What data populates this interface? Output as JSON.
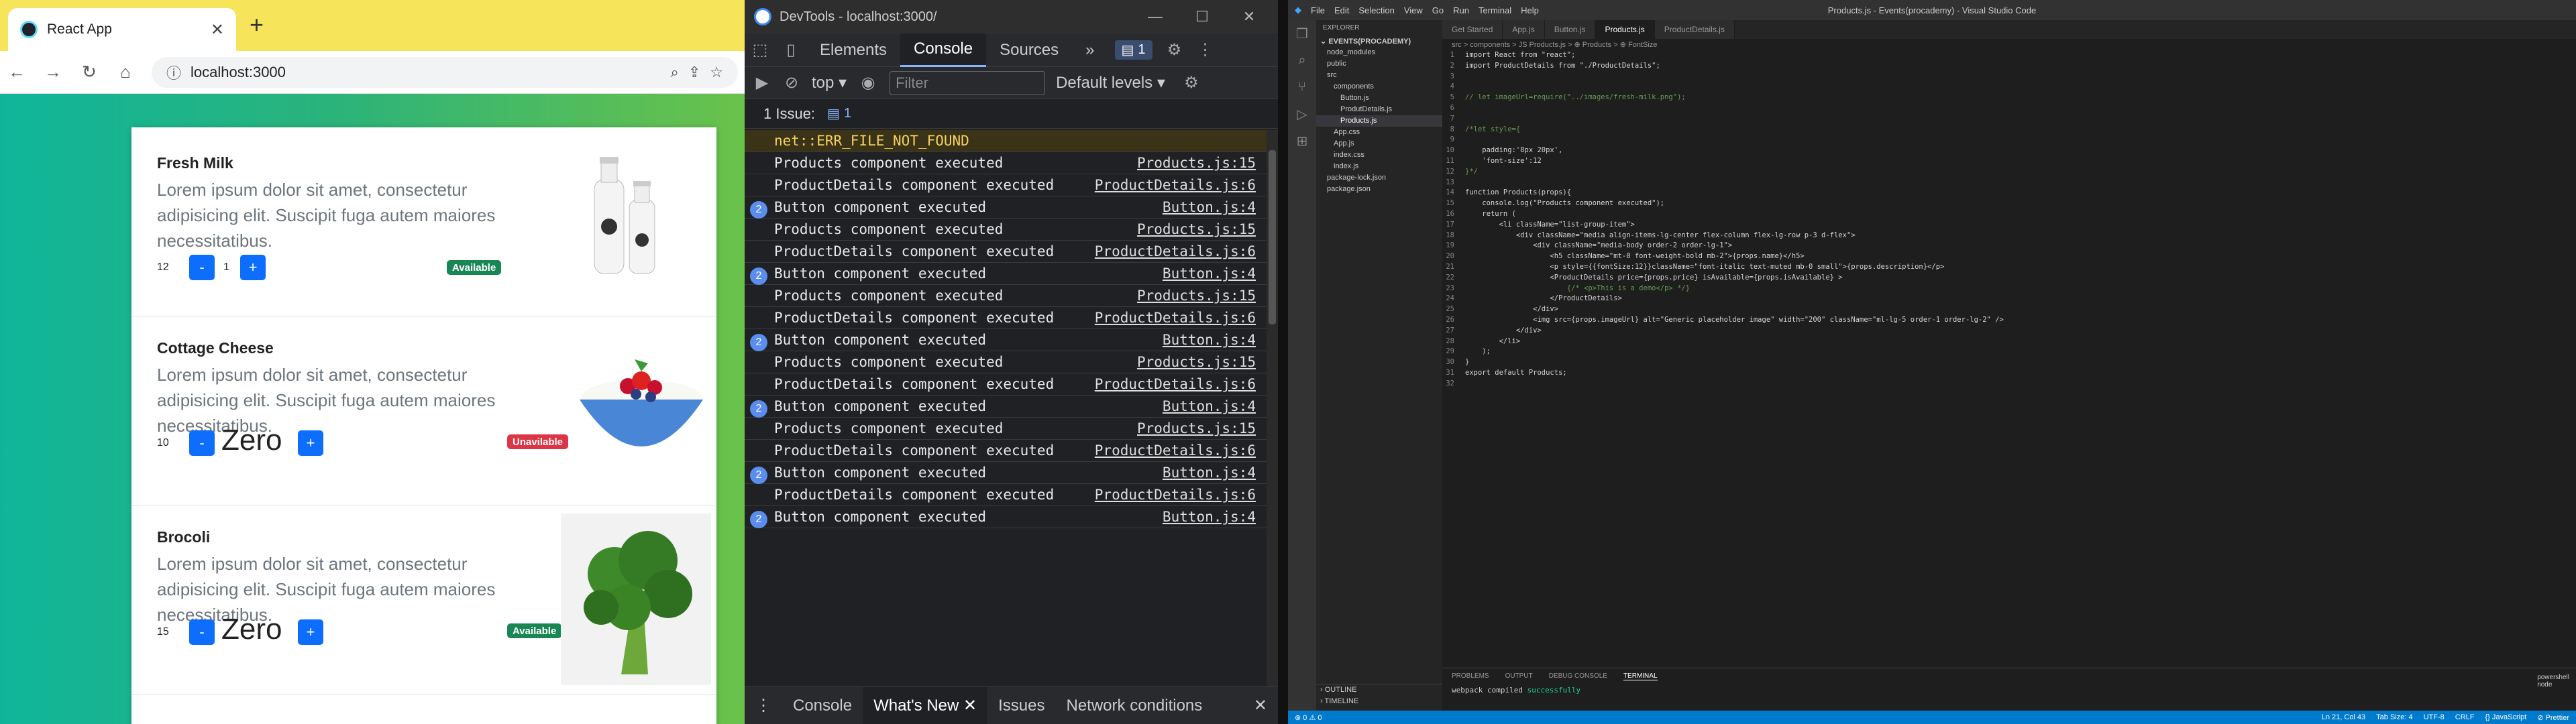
{
  "browser": {
    "tab_title": "React App",
    "tab_close": "✕",
    "new_tab": "+",
    "url": "localhost:3000",
    "nav": {
      "back": "←",
      "forward": "→",
      "reload": "↻",
      "home": "⌂"
    },
    "products": [
      {
        "name": "Fresh Milk",
        "description": "Lorem ipsum dolor sit amet, consectetur adipisicing elit. Suscipit fuga autem maiores necessitatibus.",
        "price": "12",
        "quantity": "1",
        "status": "Available",
        "status_color": "#198754",
        "minus": "-",
        "plus": "+"
      },
      {
        "name": "Cottage Cheese",
        "description": "Lorem ipsum dolor sit amet, consectetur adipisicing elit. Suscipit fuga autem maiores necessitatibus.",
        "price": "10",
        "quantity": "Zero",
        "status": "Unavilable",
        "status_color": "#dc3545",
        "minus": "-",
        "plus": "+"
      },
      {
        "name": "Brocoli",
        "description": "Lorem ipsum dolor sit amet, consectetur adipisicing elit. Suscipit fuga autem maiores necessitatibus.",
        "price": "15",
        "quantity": "Zero",
        "status": "Available",
        "status_color": "#198754",
        "minus": "-",
        "plus": "+"
      }
    ]
  },
  "devtools": {
    "title": "DevTools - localhost:3000/",
    "tabs": [
      "Elements",
      "Console",
      "Sources"
    ],
    "active_tab": "Console",
    "more_tabs": "»",
    "issue_count": "1",
    "context": "top",
    "filter_placeholder": "Filter",
    "levels": "Default levels",
    "issues_bar": "1 Issue:",
    "issues_bar_count": "1",
    "logs": [
      {
        "text": "net::ERR_FILE_NOT_FOUND",
        "source": "",
        "count": "",
        "type": "err"
      },
      {
        "text": "Products component executed",
        "source": "Products.js:15",
        "count": "",
        "type": "log"
      },
      {
        "text": "ProductDetails component executed",
        "source": "ProductDetails.js:6",
        "count": "",
        "type": "log"
      },
      {
        "text": "Button component executed",
        "source": "Button.js:4",
        "count": "2",
        "type": "log"
      },
      {
        "text": "Products component executed",
        "source": "Products.js:15",
        "count": "",
        "type": "log"
      },
      {
        "text": "ProductDetails component executed",
        "source": "ProductDetails.js:6",
        "count": "",
        "type": "log"
      },
      {
        "text": "Button component executed",
        "source": "Button.js:4",
        "count": "2",
        "type": "log"
      },
      {
        "text": "Products component executed",
        "source": "Products.js:15",
        "count": "",
        "type": "log"
      },
      {
        "text": "ProductDetails component executed",
        "source": "ProductDetails.js:6",
        "count": "",
        "type": "log"
      },
      {
        "text": "Button component executed",
        "source": "Button.js:4",
        "count": "2",
        "type": "log"
      },
      {
        "text": "Products component executed",
        "source": "Products.js:15",
        "count": "",
        "type": "log"
      },
      {
        "text": "ProductDetails component executed",
        "source": "ProductDetails.js:6",
        "count": "",
        "type": "log"
      },
      {
        "text": "Button component executed",
        "source": "Button.js:4",
        "count": "2",
        "type": "log"
      },
      {
        "text": "Products component executed",
        "source": "Products.js:15",
        "count": "",
        "type": "log"
      },
      {
        "text": "ProductDetails component executed",
        "source": "ProductDetails.js:6",
        "count": "",
        "type": "log"
      },
      {
        "text": "Button component executed",
        "source": "Button.js:4",
        "count": "2",
        "type": "log"
      },
      {
        "text": "ProductDetails component executed",
        "source": "ProductDetails.js:6",
        "count": "",
        "type": "log"
      },
      {
        "text": "Button component executed",
        "source": "Button.js:4",
        "count": "2",
        "type": "log"
      }
    ],
    "drawer_tabs": [
      "Console",
      "What's New",
      "Issues",
      "Network conditions"
    ],
    "drawer_active": "What's New"
  },
  "vscode": {
    "window_title": "Products.js - Events(procademy) - Visual Studio Code",
    "menu": [
      "File",
      "Edit",
      "Selection",
      "View",
      "Go",
      "Run",
      "Terminal",
      "Help"
    ],
    "explorer_header": "EXPLORER",
    "workspace": "EVENTS(PROCADEMY)",
    "tree": [
      "node_modules",
      "public",
      "src",
      "components",
      "Button.js",
      "ProdutDetails.js",
      "Products.js",
      "App.css",
      "App.js",
      "index.css",
      "index.js",
      "package-lock.json",
      "package.json"
    ],
    "selected_file": "Products.js",
    "outline": "OUTLINE",
    "timeline": "TIMELINE",
    "editor_tabs": [
      "Get Started",
      "App.js",
      "Button.js",
      "Products.js",
      "ProductDetails.js"
    ],
    "active_editor_tab": "Products.js",
    "breadcrumb": "src > components > JS Products.js > ⊕ Products > ⊕ FontSize",
    "code_lines": [
      "import React from \"react\";",
      "import ProductDetails from \"./ProductDetails\";",
      "",
      "",
      "// let imageUrl=require(\"../images/fresh-milk.png\");",
      "",
      "",
      "/*let style={",
      "",
      "    padding:'8px 20px',",
      "    'font-size':12",
      "}*/",
      "",
      "function Products(props){",
      "    console.log(\"Products component executed\");",
      "    return (",
      "        <li className=\"list-group-item\">",
      "            <div className=\"media align-items-lg-center flex-column flex-lg-row p-3 d-flex\">",
      "                <div className=\"media-body order-2 order-lg-1\">",
      "                    <h5 className=\"mt-0 font-weight-bold mb-2\">{props.name}</h5>",
      "                    <p style={{fontSize:12}}className=\"font-italic text-muted mb-0 small\">{props.description}</p>",
      "                    <ProductDetails price={props.price} isAvailable={props.isAvailable} >",
      "                        {/* <p>This is a demo</p> */}",
      "                    </ProductDetails>",
      "                </div>",
      "                <img src={props.imageUrl} alt=\"Generic placeholder image\" width=\"200\" className=\"ml-lg-5 order-1 order-lg-2\" />",
      "            </div>",
      "        </li>",
      "    );",
      "}",
      "export default Products;",
      ""
    ],
    "panel_tabs": [
      "PROBLEMS",
      "OUTPUT",
      "DEBUG CONSOLE",
      "TERMINAL"
    ],
    "panel_active": "TERMINAL",
    "terminal_prefix": "webpack compiled ",
    "terminal_success": "successfully",
    "terminals": [
      "powershell",
      "node"
    ],
    "status_left": "⊗ 0 ⚠ 0",
    "status_right": [
      "Ln 21, Col 43",
      "Tab Size: 4",
      "UTF-8",
      "CRLF",
      "{} JavaScript",
      "⊘ Prettier"
    ]
  }
}
